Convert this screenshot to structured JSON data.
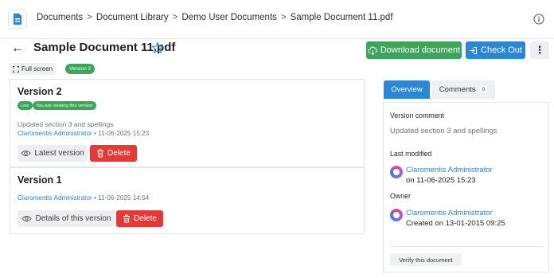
{
  "breadcrumb": {
    "items": [
      "Documents",
      "Document Library",
      "Demo User Documents",
      "Sample Document 11.pdf"
    ],
    "separator": ">"
  },
  "header": {
    "title": "Sample Document 11.pdf",
    "download_label": "Download document",
    "checkout_label": "Check Out",
    "fullscreen_label": "Full screen",
    "version_badge": "Version 2"
  },
  "versions": [
    {
      "title": "Version 2",
      "live_label": "Live",
      "viewing_label": "You are viewing this version",
      "comment": "Updated section 3 and spellings",
      "author": "Claromentis Administrator",
      "date": " • 11-06-2025 15:23",
      "view_button": "Latest version",
      "delete_button": "Delete"
    },
    {
      "title": "Version 1",
      "author": "Claromentis Administrator",
      "date": " • 11-06-2025 14:54",
      "view_button": "Details of this version",
      "delete_button": "Delete"
    }
  ],
  "panel": {
    "tabs": {
      "overview": "Overview",
      "comments": "Comments",
      "comments_count": "0"
    },
    "version_comment_label": "Version comment",
    "version_comment": "Updated section 3 and spellings",
    "last_modified_label": "Last modified",
    "last_modified_author": "Claromentis Administrator",
    "last_modified_date": "on 11-06-2025 15:23",
    "owner_label": "Owner",
    "owner_name": "Claromentis Administrator",
    "owner_created": "Created on 13-01-2015 09:25",
    "verify_label": "Verify this document"
  },
  "colors": {
    "green": "#3aa55b",
    "blue": "#2c86d6",
    "red": "#e53935"
  }
}
